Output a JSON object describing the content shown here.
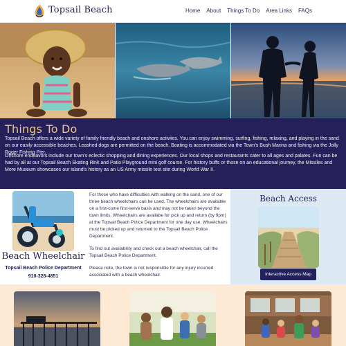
{
  "header": {
    "brand": "Topsail Beach",
    "logo_icon": "shell-logo-icon",
    "nav": [
      "Home",
      "About",
      "Things To Do",
      "Area Links",
      "FAQs"
    ]
  },
  "hero": {
    "photos": [
      "child-in-sun-hat-photo",
      "dolphins-photo",
      "couple-at-sunset-photo"
    ]
  },
  "things": {
    "title": "Things To Do",
    "p1": "Topsail Beach offers a wide variety of family friendly beach and onshore activiies. You can enjoy swimming, surfing, fishing, relaxing, and playing in the sand on our easily accessible beaches. Leashed dogs are permitted on the beach. Boating is accommodated via the Town’s Bush Marina and fishing via the Jolly Roger Fishing Pier.",
    "p2": "Offshore endeavors include our town’s eclectic shopping and dining experiences. Our local shops and restaurants cater to all ages and palates. Fun can be had by all at our Topsail Beach Skating Rink and Patio Playground mini golf course. For history buffs or those on an educational journey, the Missiles and More Museum showcases our island’s history as an US Army missile test site during World War II."
  },
  "wheelchair": {
    "title": "Beach Wheelchair",
    "department": "Topsail Beach Police Department",
    "phone": "910-328-4851",
    "p1": "For those who have difficulties with walking on the sand, one of our three beach wheelchairs can be used. The wheelchairs are available on a first-come first-serve basis and may not be taken beyond the town limits. Wheelchairs are availabe for pick up and return (by 9pm) at the Topsail Beach Police Department for one day use. Wheelchairs must be picked up and returned to the Topsail Beach Police Department.",
    "p2": "To find out availability and check out a beach wheelchair, call the Topsail Beach Police Department.",
    "p3": "Please note, the town is not responsible for any injury incurred associated with a beach wheelchair."
  },
  "access": {
    "title": "Beach Access",
    "button": "Interactive Access Map"
  },
  "colors": {
    "band": "#25205a",
    "title_gold": "#f0c685",
    "access_bg": "#dde8f5",
    "bottom_bg": "#fde9d4",
    "button": "#23215b"
  }
}
